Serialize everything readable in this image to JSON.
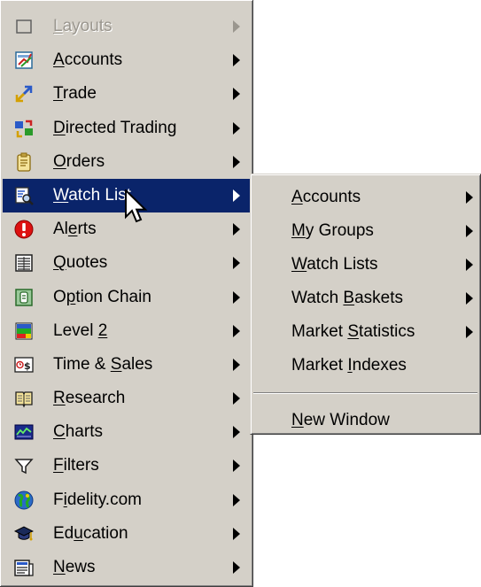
{
  "main_menu": {
    "items": [
      {
        "label": "Layouts",
        "hotkey": "L",
        "icon": "layouts-icon",
        "submenu": true,
        "disabled": true
      },
      {
        "label": "Accounts",
        "hotkey": "A",
        "icon": "accounts-icon",
        "submenu": true
      },
      {
        "label": "Trade",
        "hotkey": "T",
        "icon": "trade-icon",
        "submenu": true
      },
      {
        "label": "Directed Trading",
        "hotkey": "D",
        "icon": "directed-trading-icon",
        "submenu": true
      },
      {
        "label": "Orders",
        "hotkey": "O",
        "icon": "orders-icon",
        "submenu": true
      },
      {
        "label": "Watch List",
        "hotkey": "W",
        "icon": "watch-list-icon",
        "submenu": true,
        "highlighted": true
      },
      {
        "label": "Alerts",
        "hotkey": "e",
        "icon": "alerts-icon",
        "submenu": true
      },
      {
        "label": "Quotes",
        "hotkey": "Q",
        "icon": "quotes-icon",
        "submenu": true
      },
      {
        "label": "Option Chain",
        "hotkey": "p",
        "icon": "option-chain-icon",
        "submenu": true
      },
      {
        "label": "Level 2",
        "hotkey": "2",
        "icon": "level-2-icon",
        "submenu": true
      },
      {
        "label": "Time & Sales",
        "hotkey": "S",
        "icon": "time-and-sales-icon",
        "submenu": true
      },
      {
        "label": "Research",
        "hotkey": "R",
        "icon": "research-icon",
        "submenu": true
      },
      {
        "label": "Charts",
        "hotkey": "C",
        "icon": "charts-icon",
        "submenu": true
      },
      {
        "label": "Filters",
        "hotkey": "F",
        "icon": "filters-icon",
        "submenu": true
      },
      {
        "label": "Fidelity.com",
        "hotkey": "i",
        "icon": "fidelity-globe-icon",
        "submenu": true
      },
      {
        "label": "Education",
        "hotkey": "u",
        "icon": "education-icon",
        "submenu": true
      },
      {
        "label": "News",
        "hotkey": "N",
        "icon": "news-icon",
        "submenu": true
      }
    ]
  },
  "submenu": {
    "parent": "Watch List",
    "items": [
      {
        "label": "Accounts",
        "hotkey": "A",
        "submenu": true
      },
      {
        "label": "My Groups",
        "hotkey": "M",
        "submenu": true
      },
      {
        "label": "Watch Lists",
        "hotkey": "W",
        "submenu": true
      },
      {
        "label": "Watch Baskets",
        "hotkey": "B",
        "submenu": true
      },
      {
        "label": "Market Statistics",
        "hotkey": "S",
        "submenu": true
      },
      {
        "label": "Market Indexes",
        "hotkey": "I",
        "submenu": false
      },
      {
        "separator": true
      },
      {
        "label": "New Window",
        "hotkey": "N",
        "submenu": false
      }
    ]
  },
  "colors": {
    "menu_background": "#d4d0c8",
    "highlight": "#0a246a",
    "disabled_text": "#9a968e"
  },
  "cursor": {
    "icon": "arrow-pointer-icon"
  }
}
